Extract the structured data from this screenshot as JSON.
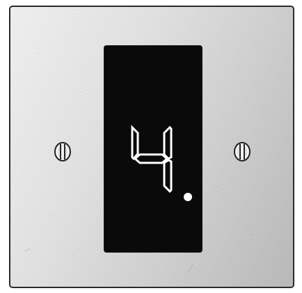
{
  "device": {
    "display_digit": "4",
    "decimal_point": ".",
    "segments_lit": [
      "b",
      "c",
      "f",
      "g"
    ],
    "decimal_point_lit": true
  },
  "colors": {
    "plate": "#e2e2e2",
    "display_background": "#0a0a0a",
    "segment_lit": "#ffffff",
    "outline": "#2a2a2a"
  },
  "icons": {
    "left_screw": "screw-icon",
    "right_screw": "screw-icon"
  }
}
